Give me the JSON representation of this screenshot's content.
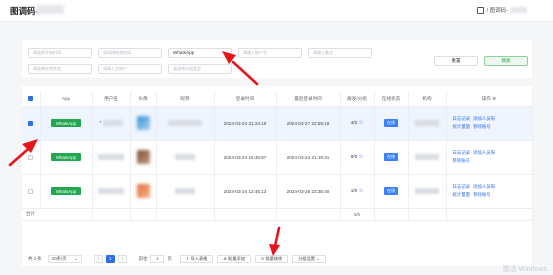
{
  "header": {
    "title": "图调码-",
    "crumb": "/ 图调码-"
  },
  "filters": {
    "row1": [
      "请选择开始时间",
      "请选择结束时间",
      "WhatsApp",
      "请输入账户号",
      "请输入备注"
    ],
    "row2": [
      "请选择在线状态",
      "请输入主账户",
      "请选择分组类型"
    ],
    "reset_label": "重置",
    "search_label": "搜索"
  },
  "table": {
    "headers": [
      "App",
      "用户名",
      "头像",
      "昵称",
      "登录时间",
      "最后登录时间",
      "群发/分组",
      "在线状态",
      "机构",
      "操作"
    ],
    "rows": [
      {
        "app": "WhatsApp",
        "name": "*",
        "login": "2024-03-24 21:24:19",
        "last": "2024-03-27 22:59:19",
        "count": "4/0",
        "status": "在线",
        "ops": [
          "日志记录",
          "添加人员呀",
          "统计量量",
          "移除账号"
        ],
        "selected": true
      },
      {
        "app": "WhatsApp",
        "name": "",
        "login": "2024-03-24 16:46:57",
        "last": "2024-03-24 21:19:41",
        "count": "0/0",
        "status": "在线",
        "ops": [
          "日志记录",
          "添加人员呀",
          "移除账号"
        ],
        "selected": false
      },
      {
        "app": "WhatsApp",
        "name": "",
        "login": "2024-03-24 12:45:13",
        "last": "2024-03-25 23:35:40",
        "count": "1/0",
        "status": "在线",
        "ops": [
          "日志记录",
          "添加人员呀",
          "统计量量",
          "移除账号"
        ],
        "selected": false
      }
    ],
    "footer": {
      "label": "合计",
      "total": "5/0"
    }
  },
  "pagination": {
    "total": "共 3 条",
    "page_size": "20条/页",
    "current": "1",
    "goto_label": "前往",
    "goto_value": "1",
    "page_unit": "页"
  },
  "actions": [
    "导入表格",
    "批量添加",
    "批量移除",
    "分组设置"
  ],
  "watermark": "激活 Windows",
  "colors": {
    "primary": "#2f6fea",
    "whatsapp": "#23a650",
    "online": "#3b82f6",
    "arrow": "#e8141c"
  }
}
